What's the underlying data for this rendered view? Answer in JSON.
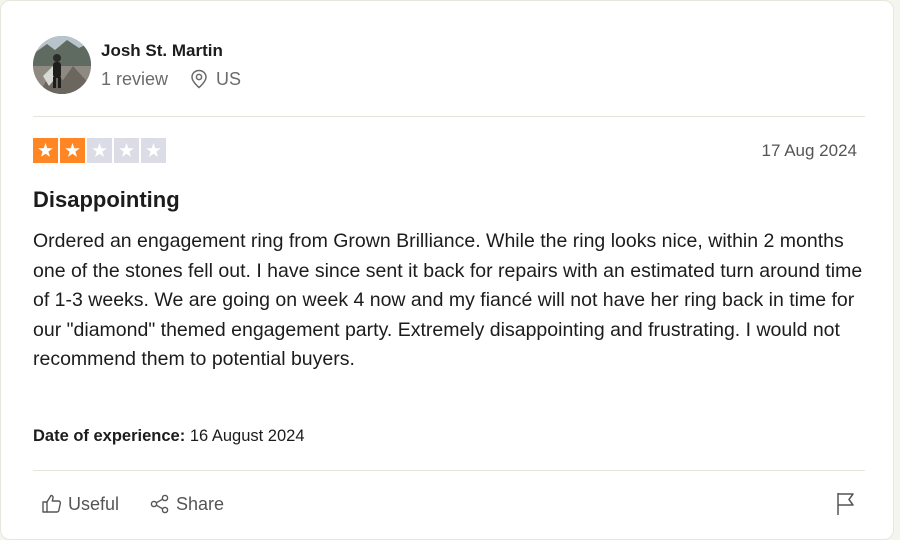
{
  "reviewer": {
    "name": "Josh St. Martin",
    "review_count": "1 review",
    "location": "US",
    "avatar_icon": "user-photo-avatar"
  },
  "review": {
    "rating": 2,
    "rating_max": 5,
    "date": "17 Aug 2024",
    "title": "Disappointing",
    "body": "Ordered an engagement ring from Grown Brilliance. While the ring looks nice, within 2 months one of the stones fell out. I have since sent it back for repairs with an estimated turn around time of 1-3 weeks. We are going on week 4 now and my fiancé will not have her ring back in time for our \"diamond\" themed engagement party. Extremely disappointing and frustrating. I would not recommend them to potential buyers.",
    "experience_label": "Date of experience:",
    "experience_date": "16 August 2024"
  },
  "actions": {
    "useful_label": "Useful",
    "share_label": "Share",
    "useful_icon": "thumbs-up-icon",
    "share_icon": "share-icon",
    "flag_icon": "flag-icon"
  },
  "colors": {
    "star_filled": "#ff8622",
    "star_empty": "#dcdce6",
    "text": "#1c1c1c",
    "muted": "#6b6b6b"
  }
}
